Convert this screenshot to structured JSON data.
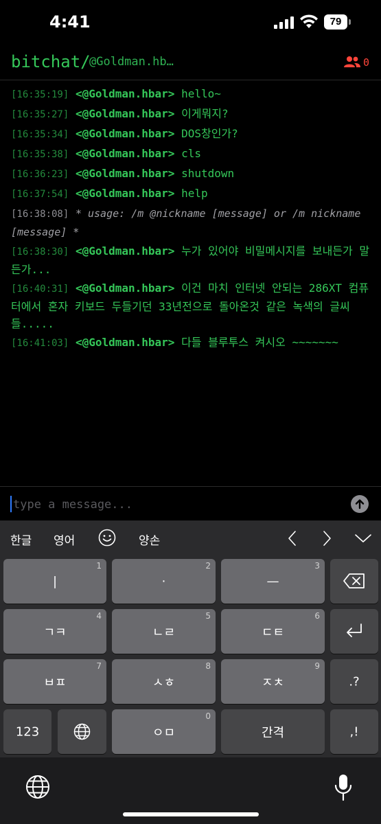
{
  "status": {
    "time": "4:41",
    "battery": "79"
  },
  "header": {
    "app_name": "bitchat/",
    "channel": "@Goldman.hb…",
    "peer_count": "0",
    "peer_color": "#ff453a"
  },
  "messages": [
    {
      "time": "[16:35:19]",
      "nick": "<@Goldman.hbar>",
      "text": "hello~"
    },
    {
      "time": "[16:35:27]",
      "nick": "<@Goldman.hbar>",
      "text": "이게뭐지?"
    },
    {
      "time": "[16:35:34]",
      "nick": "<@Goldman.hbar>",
      "text": "DOS창인가?"
    },
    {
      "time": "[16:35:38]",
      "nick": "<@Goldman.hbar>",
      "text": "cls"
    },
    {
      "time": "[16:36:23]",
      "nick": "<@Goldman.hbar>",
      "text": "shutdown"
    },
    {
      "time": "[16:37:54]",
      "nick": "<@Goldman.hbar>",
      "text": "help"
    },
    {
      "time": "[16:38:08]",
      "system": "* usage: /m @nickname [message] or /m nickname [message] *"
    },
    {
      "time": "[16:38:30]",
      "nick": "<@Goldman.hbar>",
      "text": "누가 있어야 비밀메시지를 보내든가 말든가..."
    },
    {
      "time": "[16:40:31]",
      "nick": "<@Goldman.hbar>",
      "text": "이건 마치 인터넷 안되는 286XT 컴퓨터에서 혼자 키보드 두들기던 33년전으로 돌아온것 같은 녹색의 글씨들....."
    },
    {
      "time": "[16:41:03]",
      "nick": "<@Goldman.hbar>",
      "text": "다들 블루투스 켜시오 ~~~~~~~"
    }
  ],
  "input": {
    "placeholder": "type a message..."
  },
  "colors": {
    "accent": "#35c759",
    "timestamp": "#248a3d"
  },
  "keyboard": {
    "toolbar": {
      "korean": "한글",
      "english": "영어",
      "honorific": "양손"
    },
    "rows": [
      [
        {
          "label": "|",
          "num": "1"
        },
        {
          "label": "·",
          "num": "2"
        },
        {
          "label": "—",
          "num": "3"
        }
      ],
      [
        {
          "label": "ㄱㅋ",
          "num": "4"
        },
        {
          "label": "ㄴㄹ",
          "num": "5"
        },
        {
          "label": "ㄷㅌ",
          "num": "6"
        }
      ],
      [
        {
          "label": "ㅂㅍ",
          "num": "7"
        },
        {
          "label": "ㅅㅎ",
          "num": "8"
        },
        {
          "label": "ㅈㅊ",
          "num": "9"
        }
      ]
    ],
    "numbers_key": "123",
    "zero_key": {
      "label": "ㅇㅁ",
      "num": "0"
    },
    "space_key": "간격",
    "punct_key_1": ".?",
    "punct_key_2": ",!"
  }
}
